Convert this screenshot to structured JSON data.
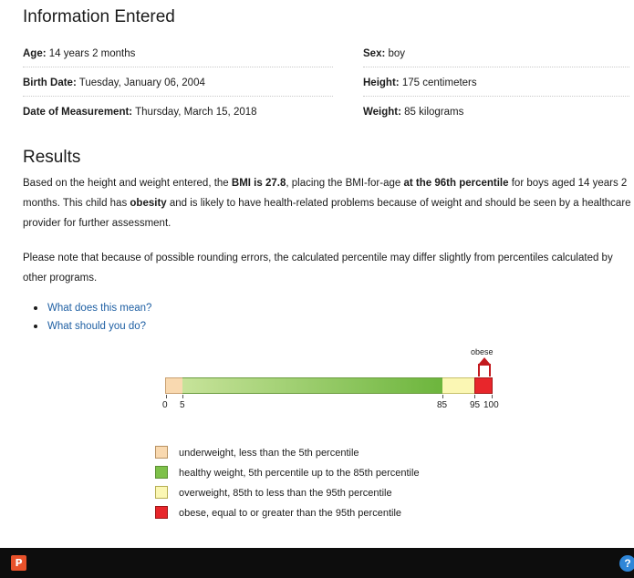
{
  "info": {
    "title": "Information Entered",
    "rows": [
      {
        "left_label": "Age:",
        "left_value": "14 years 2 months",
        "right_label": "Sex:",
        "right_value": "boy"
      },
      {
        "left_label": "Birth Date:",
        "left_value": "Tuesday, January 06, 2004",
        "right_label": "Height:",
        "right_value": "175 centimeters"
      },
      {
        "left_label": "Date of Measurement:",
        "left_value": "Thursday, March 15, 2018",
        "right_label": "Weight:",
        "right_value": "85 kilograms"
      }
    ]
  },
  "results": {
    "title": "Results",
    "p1": {
      "t1": "Based on the height and weight entered, the ",
      "b1": "BMI is 27.8",
      "t2": ", placing the BMI-for-age ",
      "b2": "at the 96th percentile",
      "t3": " for boys aged 14 years 2 months. This child has ",
      "b3": "obesity",
      "t4": " and is likely to have health-related problems because of weight and should be seen by a healthcare provider for further assessment."
    },
    "p2": "Please note that because of possible rounding errors, the calculated percentile may differ slightly from percentiles calculated by other programs.",
    "links": [
      "What does this mean?",
      "What should you do?"
    ]
  },
  "bar": {
    "marker_label": "obese",
    "percentile": 96,
    "ticks": [
      "0",
      "5",
      "85",
      "95",
      "100"
    ],
    "colors": {
      "underweight": "#f9d9b0",
      "healthy": "#7ec14a",
      "overweight": "#fbf7b4",
      "obese": "#e8262b"
    }
  },
  "legend": [
    {
      "key": "underweight",
      "label": "underweight, less than the 5th percentile"
    },
    {
      "key": "healthy",
      "label": "healthy weight, 5th percentile up to the 85th percentile"
    },
    {
      "key": "overweight",
      "label": "overweight, 85th to less than the 95th percentile"
    },
    {
      "key": "obese",
      "label": "obese, equal to or greater than the 95th percentile"
    }
  ],
  "taskbar": {
    "app_icon": "P",
    "help_icon": "?"
  }
}
